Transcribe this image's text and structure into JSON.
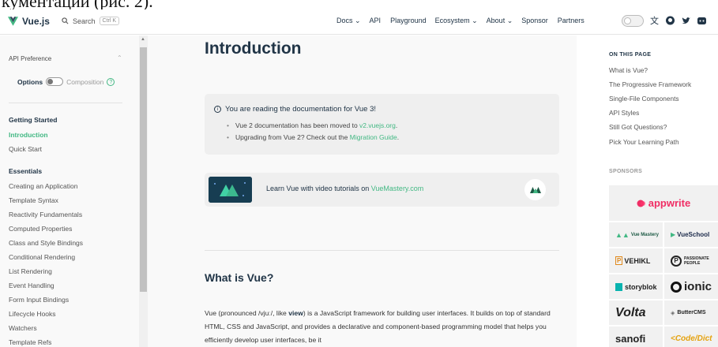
{
  "caption_fragment": "кументации (рис. 2).",
  "navbar": {
    "logo_text": "Vue.js",
    "search_label": "Search",
    "search_kbd": "Ctrl K",
    "links": [
      "Docs ⌄",
      "API",
      "Playground",
      "Ecosystem ⌄",
      "About ⌄",
      "Sponsor",
      "Partners"
    ]
  },
  "sidebar": {
    "api_preference": "API Preference",
    "option_on": "Options",
    "option_off": "Composition",
    "help_glyph": "?",
    "sections": [
      {
        "title": "Getting Started",
        "items": [
          "Introduction",
          "Quick Start"
        ]
      },
      {
        "title": "Essentials",
        "items": [
          "Creating an Application",
          "Template Syntax",
          "Reactivity Fundamentals",
          "Computed Properties",
          "Class and Style Bindings",
          "Conditional Rendering",
          "List Rendering",
          "Event Handling",
          "Form Input Bindings",
          "Lifecycle Hooks",
          "Watchers",
          "Template Refs"
        ]
      }
    ],
    "active_item": "Introduction"
  },
  "main": {
    "title": "Introduction",
    "tip": {
      "icon": "i",
      "heading": "You are reading the documentation for Vue 3!",
      "line1_prefix": "Vue 2 documentation has been moved to ",
      "line1_link": "v2.vuejs.org",
      "line1_suffix": ".",
      "line2_prefix": "Upgrading from Vue 2? Check out the ",
      "line2_link": "Migration Guide",
      "line2_suffix": "."
    },
    "banner": {
      "text_prefix": "Learn Vue with video tutorials on ",
      "text_link": "VueMastery.com"
    },
    "h2": "What is Vue?",
    "para_1": "Vue (pronounced /vjuː/, like ",
    "para_bold": "view",
    "para_2": ") is a JavaScript framework for building user interfaces. It builds on top of standard HTML, CSS and JavaScript, and provides a declarative and component-based programming model that helps you efficiently develop user interfaces, be it"
  },
  "aside": {
    "on_this_page": "ON THIS PAGE",
    "toc": [
      "What is Vue?",
      "The Progressive Framework",
      "Single-File Components",
      "API Styles",
      "Still Got Questions?",
      "Pick Your Learning Path"
    ],
    "sponsors_title": "SPONSORS",
    "sponsor_wide": "appwrite",
    "sponsor_rows": [
      [
        "Vue Mastery",
        "VueSchool"
      ],
      [
        "VEHIKL",
        "PASSIONATE PEOPLE"
      ],
      [
        "storyblok",
        "ionic"
      ],
      [
        "Volta",
        "ButterCMS"
      ],
      [
        "sanofi",
        "<Code/Dict"
      ]
    ]
  },
  "colors": {
    "accent": "#42b883",
    "text": "#213547",
    "sidebar_bg": "#f9f9f9",
    "tip_bg": "#efefef",
    "appwrite": "#f02e65"
  }
}
